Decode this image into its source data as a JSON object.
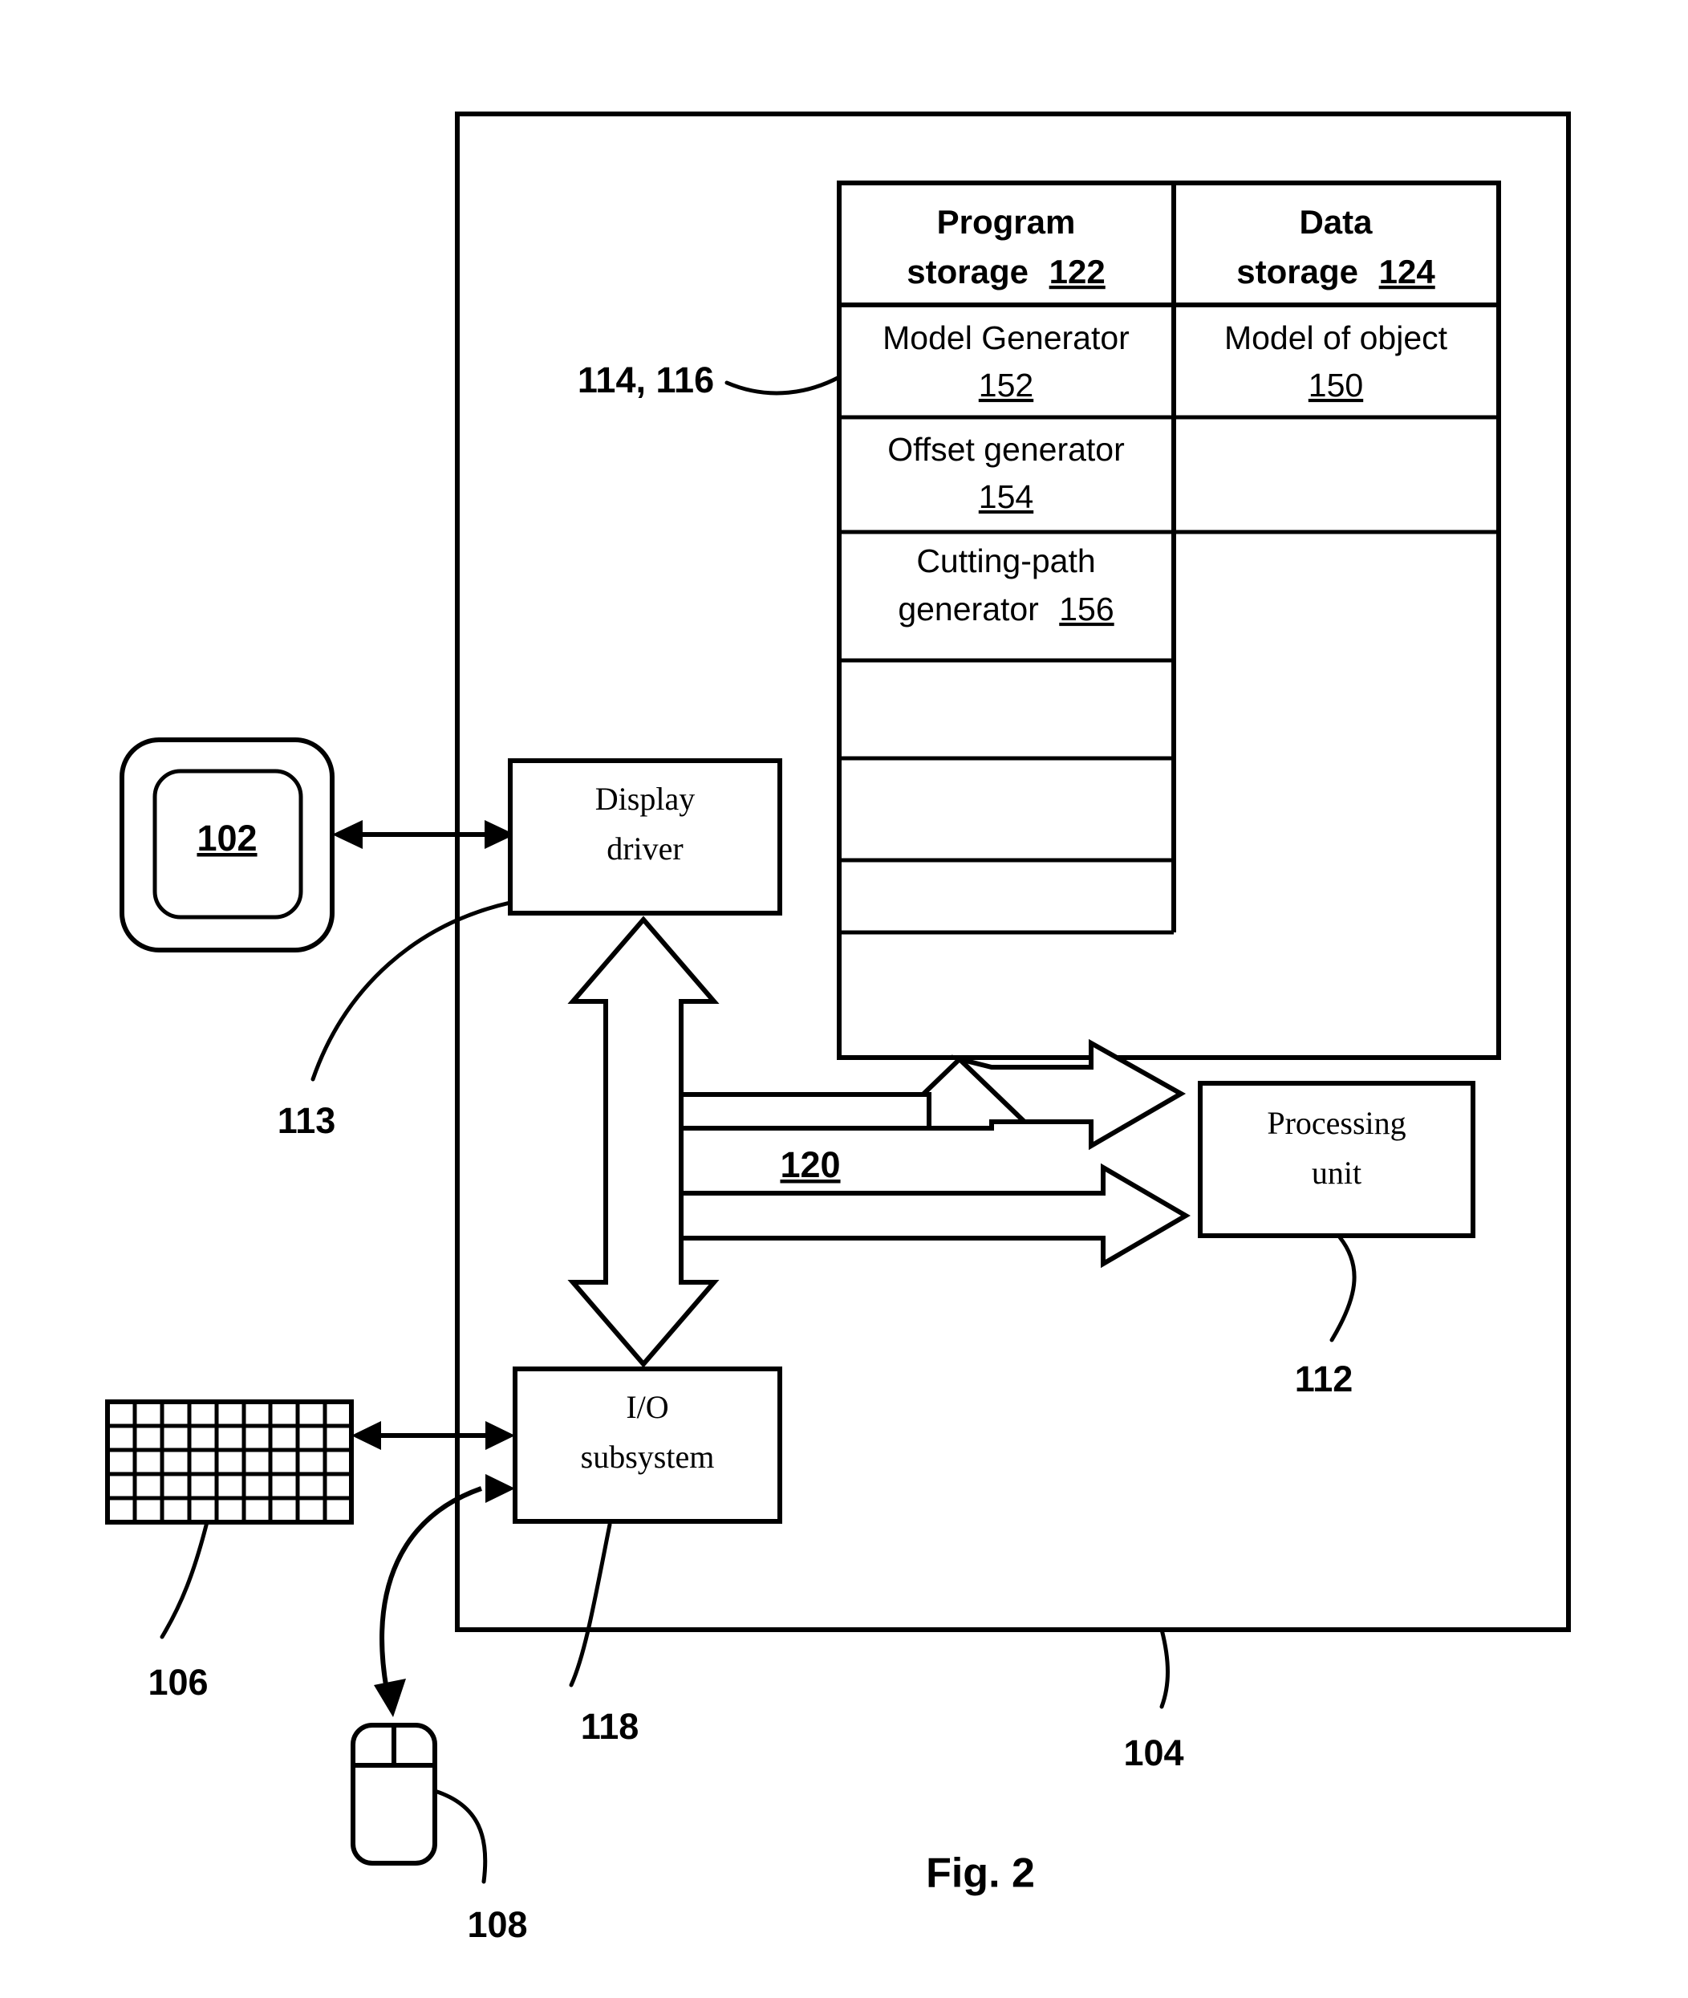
{
  "figure": {
    "caption": "Fig. 2"
  },
  "storage_table": {
    "headers": {
      "program": {
        "line1": "Program",
        "line2": "storage",
        "ref": "122"
      },
      "data": {
        "line1": "Data",
        "line2": "storage",
        "ref": "124"
      }
    },
    "program_column": [
      {
        "line1": "Model Generator",
        "line2": "",
        "ref": "152"
      },
      {
        "line1": "Offset generator",
        "line2": "",
        "ref": "154"
      },
      {
        "line1": "Cutting-path",
        "line2": "generator",
        "ref": "156"
      },
      {
        "line1": "",
        "line2": "",
        "ref": ""
      },
      {
        "line1": "",
        "line2": "",
        "ref": ""
      },
      {
        "line1": "",
        "line2": "",
        "ref": ""
      }
    ],
    "data_column": [
      {
        "line1": "Model of object",
        "line2": "",
        "ref": "150"
      },
      {
        "line1": "",
        "line2": "",
        "ref": ""
      },
      {
        "line1": "",
        "line2": "",
        "ref": ""
      }
    ]
  },
  "blocks": {
    "display_driver": {
      "line1": "Display",
      "line2": "driver"
    },
    "processing_unit": {
      "line1": "Processing",
      "line2": "unit"
    },
    "io_subsystem": {
      "line1": "I/O",
      "line2": "subsystem"
    },
    "display": {
      "ref": "102"
    }
  },
  "reference_numerals": {
    "computer": "104",
    "keyboard": "106",
    "mouse": "108",
    "processing_unit": "112",
    "display_link": "113",
    "memory": "114, 116",
    "io_subsystem": "118",
    "bus": "120"
  },
  "colors": {
    "line": "#000000",
    "background": "#ffffff"
  }
}
